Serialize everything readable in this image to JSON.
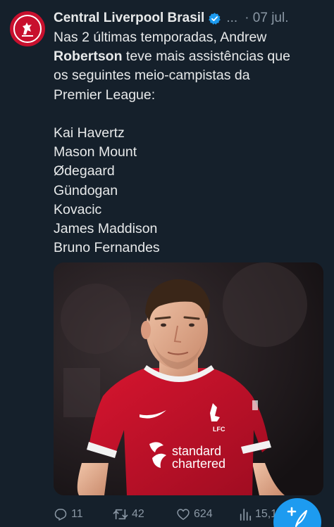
{
  "author": {
    "name": "Central Liverpool Brasil",
    "more": "...",
    "date": "· 07 jul."
  },
  "tweet": {
    "line1": "Nas 2 últimas temporadas, Andrew",
    "bold_name": "Robertson",
    "line2_rest": " teve mais assistências que",
    "line3": "os seguintes meio-campistas da",
    "line4": "Premier League:",
    "players": [
      "Kai Havertz",
      "Mason Mount",
      "Ødegaard",
      "Gündogan",
      "Kovacic",
      "James Maddison",
      "Bruno Fernandes"
    ]
  },
  "media": {
    "sponsor_line1": "standard",
    "sponsor_line2": "chartered",
    "crest_text": "LFC"
  },
  "actions": {
    "replies": "11",
    "retweets": "42",
    "likes": "624",
    "views": "15,1"
  },
  "colors": {
    "background": "#15202b",
    "accent": "#1d9bf0",
    "muted": "#8b98a5",
    "shirt": "#c8102e"
  },
  "icons": [
    "reply-icon",
    "retweet-icon",
    "like-icon",
    "views-icon",
    "compose-icon",
    "verified-icon"
  ]
}
